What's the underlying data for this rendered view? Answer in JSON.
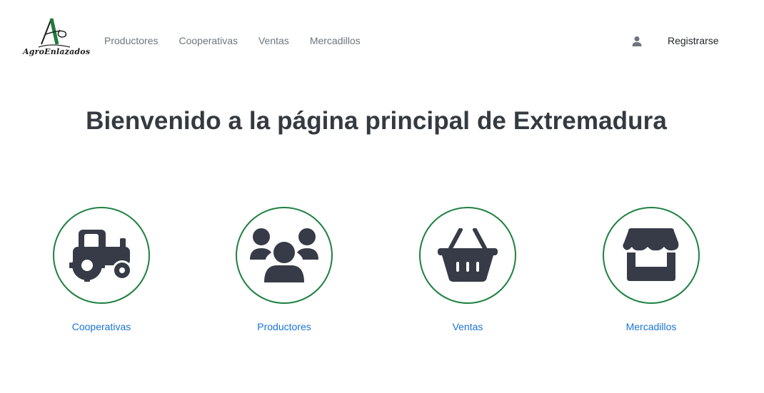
{
  "brand": {
    "logo_text": "AgroEnlazados"
  },
  "nav": {
    "items": [
      {
        "label": "Productores"
      },
      {
        "label": "Cooperativas"
      },
      {
        "label": "Ventas"
      },
      {
        "label": "Mercadillos"
      }
    ],
    "user_icon": "user-icon",
    "register_label": "Registrarse"
  },
  "hero": {
    "title": "Bienvenido a la página principal de Extremadura"
  },
  "cards": [
    {
      "label": "Cooperativas",
      "icon": "tractor-icon"
    },
    {
      "label": "Productores",
      "icon": "users-icon"
    },
    {
      "label": "Ventas",
      "icon": "basket-icon"
    },
    {
      "label": "Mercadillos",
      "icon": "store-icon"
    }
  ],
  "colors": {
    "circle_border": "#1e8040",
    "icon_fill": "#363b47",
    "link": "#1a73d9",
    "logo_green": "#1e7a3c"
  }
}
